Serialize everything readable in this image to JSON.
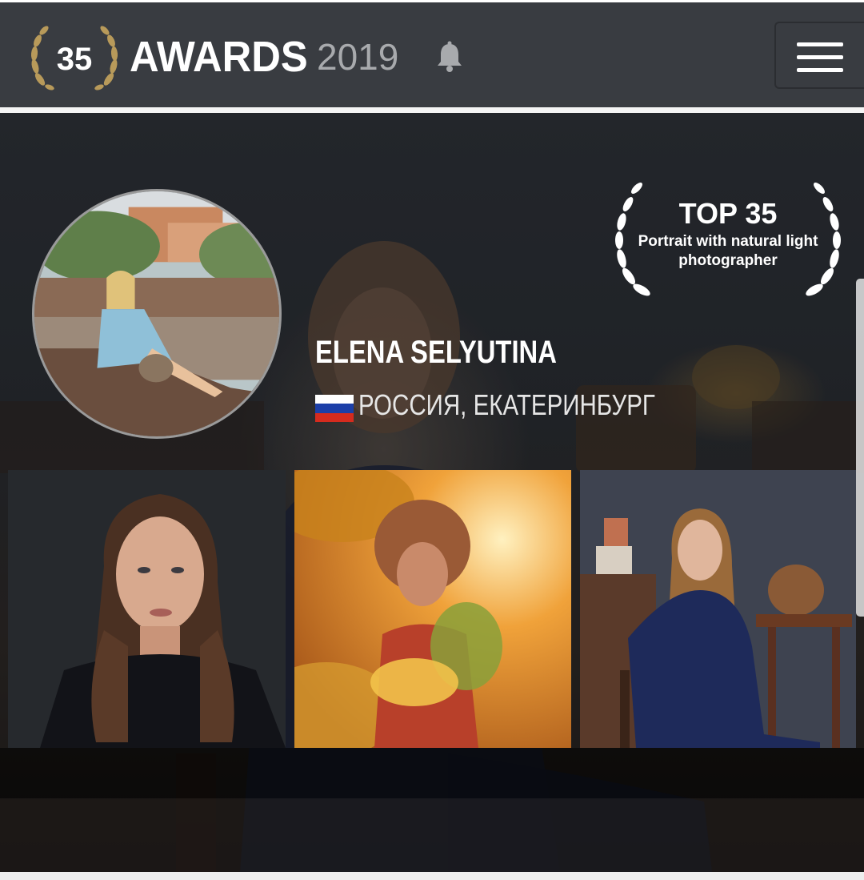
{
  "header": {
    "logo_text": "35",
    "brand": "AWARDS",
    "year": "2019",
    "icons": {
      "logo": "laurel-logo-icon",
      "notifications": "bell-icon",
      "menu": "hamburger-menu-icon"
    }
  },
  "profile": {
    "name": "ELENA SELYUTINA",
    "location": "РОССИЯ, ЕКАТЕРИНБУРГ",
    "flag": "russia-flag-icon",
    "badge": {
      "title": "TOP 35",
      "line1": "Portrait with natural light",
      "line2": "photographer"
    }
  },
  "gallery": [
    {
      "subject": "portrait-woman-dark-background"
    },
    {
      "subject": "child-with-autumn-leaves"
    },
    {
      "subject": "woman-seated-in-room"
    }
  ],
  "colors": {
    "header_bg": "#393c41",
    "text": "#ffffff",
    "year_text": "#a8aaad",
    "laurel_gold": "#b89a5a"
  }
}
